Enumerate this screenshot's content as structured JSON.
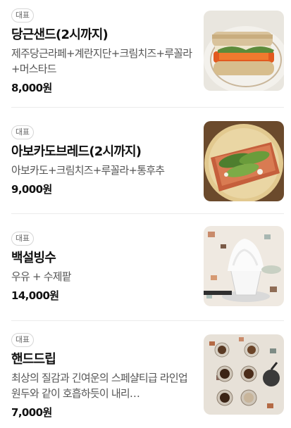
{
  "menu": {
    "items": [
      {
        "badge": "대표",
        "name": "당근샌드(2시까지)",
        "description": "제주당근라페+계란지단+크림치즈+루꼴라+머스타드",
        "price": "8,000원",
        "image": "carrot-sandwich-photo"
      },
      {
        "badge": "대표",
        "name": "아보카도브레드(2시까지)",
        "description": "아보카도+크림치즈+루꼴라+통후추",
        "price": "9,000원",
        "image": "avocado-toast-photo"
      },
      {
        "badge": "대표",
        "name": "백설빙수",
        "description": "우유 + 수제팥",
        "price": "14,000원",
        "image": "shaved-ice-photo"
      },
      {
        "badge": "대표",
        "name": "핸드드립",
        "description": "최상의 질감과 긴여운의 스페샬티급 라인업 원두와 같이 호흡하듯이 내리…",
        "price": "7,000원",
        "image": "hand-drip-coffee-photo"
      }
    ]
  }
}
